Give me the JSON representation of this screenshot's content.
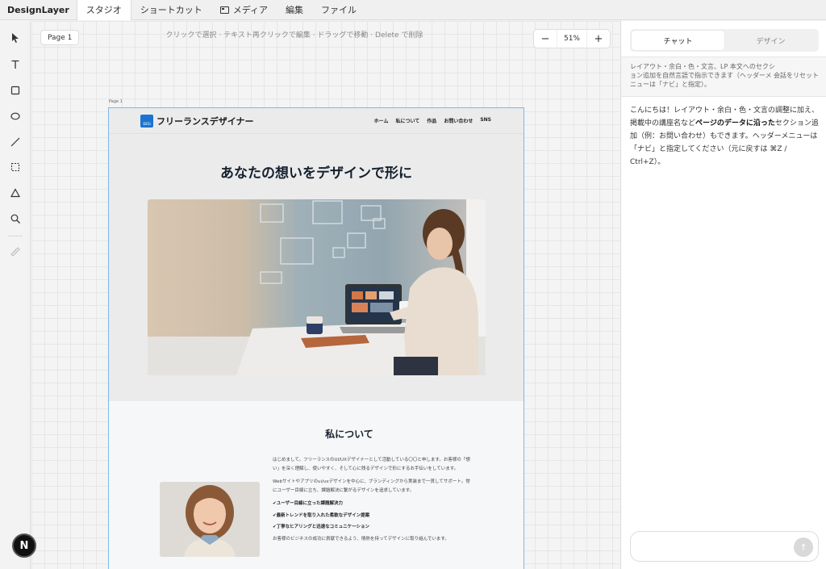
{
  "app": {
    "brand": "DesignLayer"
  },
  "menu": {
    "items": [
      "スタジオ",
      "ショートカット",
      "メディア",
      "編集",
      "ファイル"
    ],
    "active_index": 0
  },
  "canvas": {
    "page_badge": "Page 1",
    "hint": "クリックで選択 · テキスト再クリックで編集 · ドラッグで移動 · Delete で削除",
    "zoom": {
      "minus": "−",
      "value": "51%",
      "plus": "+"
    },
    "page_label": "Page 1"
  },
  "lp": {
    "logo_mark": "DESI",
    "logo_text": "フリーランスデザイナー",
    "nav": [
      "ホーム",
      "私について",
      "作品",
      "お問い合わせ",
      "SNS"
    ],
    "hero_title": "あなたの想いをデザインで形に",
    "about": {
      "title": "私について",
      "p1": "はじめまして。フリーランスのUI/UXデザイナーとして活動している〇〇と申します。お客様の「想い」を深く理解し、使いやすく、そして心に残るデザインで形にするお手伝いをしています。",
      "p2": "Webサイトやアプリのui/uxデザインを中心に、ブランディングから実装まで一貫してサポート。常にユーザー目線に立ち、課題解決に繋がるデザインを追求しています。",
      "checks": [
        "ユーザー目線に立った課題解決力",
        "最新トレンドを取り入れた柔軟なデザイン提案",
        "丁寧なヒアリングと迅速なコミュニケーション"
      ],
      "p3": "お客様のビジネスの成功に貢献できるよう、情熱を持ってデザインに取り組んでいます。"
    }
  },
  "user_avatar": "N",
  "panel": {
    "tabs": [
      "チャット",
      "デザイン"
    ],
    "active_tab": 0,
    "help": "レイアウト・余白・色・文言、LP 本文へのセクション追加を自然言語で指示できます（ヘッダーメニューは「ナビ」と指定）。",
    "reset": "会話をリセット",
    "message_pre": "こんにちは！レイアウト・余白・色・文言の調整に加え、掲載中の講座名など",
    "message_bold": "ページのデータに沿った",
    "message_post": "セクション追加（例：お問い合わせ）もできます。ヘッダーメニューは「ナビ」と指定してください（元に戻すは ⌘Z / Ctrl+Z）。",
    "input_placeholder": "",
    "send_icon": "↑"
  },
  "colors": {
    "accent": "#1b74d0",
    "frame_border": "#7fb7e8",
    "hero_title": "#15202e"
  }
}
